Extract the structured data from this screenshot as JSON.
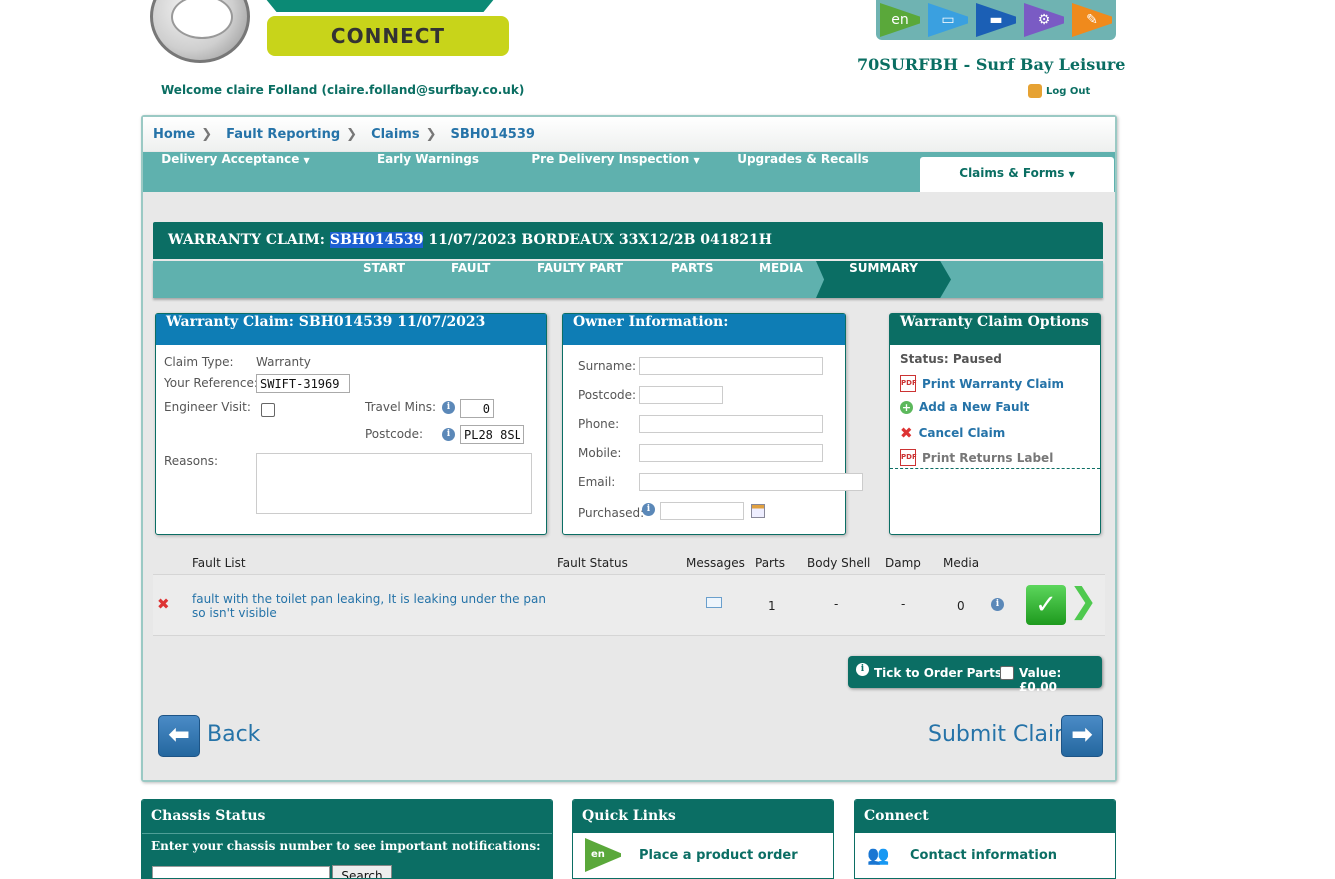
{
  "header": {
    "connect_label": "CONNECT",
    "dealer": "70SURFBH - Surf Bay Leisure",
    "welcome": "Welcome claire Folland (claire.folland@surfbay.co.uk)",
    "logout": "Log Out",
    "top_icons": [
      {
        "name": "en-icon",
        "color": "#5aa83a",
        "glyph": "en"
      },
      {
        "name": "laptop-icon",
        "color": "#3aa0e0",
        "glyph": "💻"
      },
      {
        "name": "truck-icon",
        "color": "#1b5fb5",
        "glyph": "🚚"
      },
      {
        "name": "gear-icon",
        "color": "#7a5bc4",
        "glyph": "⚙"
      },
      {
        "name": "tools-icon",
        "color": "#f08a1c",
        "glyph": "🔧"
      }
    ]
  },
  "breadcrumb": [
    "Home",
    "Fault Reporting",
    "Claims",
    "SBH014539"
  ],
  "nav": {
    "items": [
      "Delivery Acceptance",
      "Early Warnings",
      "Pre Delivery Inspection",
      "Upgrades & Recalls",
      "Claims & Forms"
    ],
    "active": "Claims & Forms"
  },
  "claim": {
    "prefix": "WARRANTY CLAIM: ",
    "number": "SBH014539",
    "rest": " 11/07/2023 BORDEAUX 33X12/2B 041821H"
  },
  "steps": [
    "START",
    "FAULT",
    "FAULTY PART",
    "PARTS",
    "MEDIA",
    "SUMMARY"
  ],
  "active_step": "SUMMARY",
  "warranty_panel": {
    "title": "Warranty Claim: SBH014539 11/07/2023",
    "claim_type_label": "Claim Type:",
    "claim_type_value": "Warranty",
    "reference_label": "Your Reference:",
    "reference_value": "SWIFT-31969",
    "engineer_label": "Engineer Visit:",
    "travel_label": "Travel Mins:",
    "travel_value": "0",
    "postcode_label": "Postcode:",
    "postcode_value": "PL28 8SL",
    "reasons_label": "Reasons:"
  },
  "owner_panel": {
    "title": "Owner Information:",
    "fields": [
      "Surname:",
      "Postcode:",
      "Phone:",
      "Mobile:",
      "Email:",
      "Purchased:"
    ]
  },
  "options_panel": {
    "title": "Warranty Claim Options",
    "status": "Status: Paused",
    "items": [
      "Print Warranty Claim",
      "Add a New Fault",
      "Cancel Claim",
      "Print Returns Label"
    ]
  },
  "fault_list": {
    "headers": [
      "Fault List",
      "Fault Status",
      "Messages",
      "Parts",
      "Body Shell",
      "Damp",
      "Media"
    ],
    "rows": [
      {
        "description": "fault with the toilet pan leaking, It is leaking under the pan so isn't visible",
        "status": "",
        "parts": "1",
        "body_shell": "-",
        "damp": "-",
        "media": "0"
      }
    ]
  },
  "order": {
    "tick_label": "Tick to Order Parts:",
    "value_label": "Value: £0.00"
  },
  "actions": {
    "back": "Back",
    "submit": "Submit Claim"
  },
  "bottom": {
    "chassis_title": "Chassis Status",
    "chassis_prompt": "Enter your chassis number to see important notifications:",
    "search_label": "Search",
    "quick_title": "Quick Links",
    "quick_item": "Place a product order",
    "connect_title": "Connect",
    "connect_item": "Contact information"
  },
  "colors": {
    "primary": "#0b6e64",
    "nav": "#5fb1ae",
    "link": "#2573a8",
    "panel_blue": "#0e7db5"
  }
}
